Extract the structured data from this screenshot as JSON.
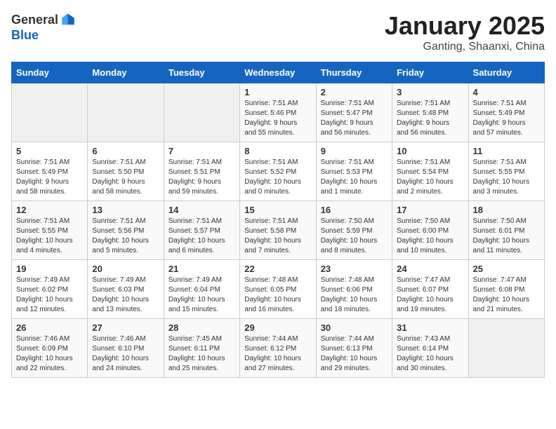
{
  "header": {
    "logo_general": "General",
    "logo_blue": "Blue",
    "title": "January 2025",
    "subtitle": "Ganting, Shaanxi, China"
  },
  "days_of_week": [
    "Sunday",
    "Monday",
    "Tuesday",
    "Wednesday",
    "Thursday",
    "Friday",
    "Saturday"
  ],
  "weeks": [
    [
      {
        "day": "",
        "info": ""
      },
      {
        "day": "",
        "info": ""
      },
      {
        "day": "",
        "info": ""
      },
      {
        "day": "1",
        "info": "Sunrise: 7:51 AM\nSunset: 5:46 PM\nDaylight: 9 hours\nand 55 minutes."
      },
      {
        "day": "2",
        "info": "Sunrise: 7:51 AM\nSunset: 5:47 PM\nDaylight: 9 hours\nand 56 minutes."
      },
      {
        "day": "3",
        "info": "Sunrise: 7:51 AM\nSunset: 5:48 PM\nDaylight: 9 hours\nand 56 minutes."
      },
      {
        "day": "4",
        "info": "Sunrise: 7:51 AM\nSunset: 5:49 PM\nDaylight: 9 hours\nand 57 minutes."
      }
    ],
    [
      {
        "day": "5",
        "info": "Sunrise: 7:51 AM\nSunset: 5:49 PM\nDaylight: 9 hours\nand 58 minutes."
      },
      {
        "day": "6",
        "info": "Sunrise: 7:51 AM\nSunset: 5:50 PM\nDaylight: 9 hours\nand 58 minutes."
      },
      {
        "day": "7",
        "info": "Sunrise: 7:51 AM\nSunset: 5:51 PM\nDaylight: 9 hours\nand 59 minutes."
      },
      {
        "day": "8",
        "info": "Sunrise: 7:51 AM\nSunset: 5:52 PM\nDaylight: 10 hours\nand 0 minutes."
      },
      {
        "day": "9",
        "info": "Sunrise: 7:51 AM\nSunset: 5:53 PM\nDaylight: 10 hours\nand 1 minute."
      },
      {
        "day": "10",
        "info": "Sunrise: 7:51 AM\nSunset: 5:54 PM\nDaylight: 10 hours\nand 2 minutes."
      },
      {
        "day": "11",
        "info": "Sunrise: 7:51 AM\nSunset: 5:55 PM\nDaylight: 10 hours\nand 3 minutes."
      }
    ],
    [
      {
        "day": "12",
        "info": "Sunrise: 7:51 AM\nSunset: 5:55 PM\nDaylight: 10 hours\nand 4 minutes."
      },
      {
        "day": "13",
        "info": "Sunrise: 7:51 AM\nSunset: 5:56 PM\nDaylight: 10 hours\nand 5 minutes."
      },
      {
        "day": "14",
        "info": "Sunrise: 7:51 AM\nSunset: 5:57 PM\nDaylight: 10 hours\nand 6 minutes."
      },
      {
        "day": "15",
        "info": "Sunrise: 7:51 AM\nSunset: 5:58 PM\nDaylight: 10 hours\nand 7 minutes."
      },
      {
        "day": "16",
        "info": "Sunrise: 7:50 AM\nSunset: 5:59 PM\nDaylight: 10 hours\nand 8 minutes."
      },
      {
        "day": "17",
        "info": "Sunrise: 7:50 AM\nSunset: 6:00 PM\nDaylight: 10 hours\nand 10 minutes."
      },
      {
        "day": "18",
        "info": "Sunrise: 7:50 AM\nSunset: 6:01 PM\nDaylight: 10 hours\nand 11 minutes."
      }
    ],
    [
      {
        "day": "19",
        "info": "Sunrise: 7:49 AM\nSunset: 6:02 PM\nDaylight: 10 hours\nand 12 minutes."
      },
      {
        "day": "20",
        "info": "Sunrise: 7:49 AM\nSunset: 6:03 PM\nDaylight: 10 hours\nand 13 minutes."
      },
      {
        "day": "21",
        "info": "Sunrise: 7:49 AM\nSunset: 6:04 PM\nDaylight: 10 hours\nand 15 minutes."
      },
      {
        "day": "22",
        "info": "Sunrise: 7:48 AM\nSunset: 6:05 PM\nDaylight: 10 hours\nand 16 minutes."
      },
      {
        "day": "23",
        "info": "Sunrise: 7:48 AM\nSunset: 6:06 PM\nDaylight: 10 hours\nand 18 minutes."
      },
      {
        "day": "24",
        "info": "Sunrise: 7:47 AM\nSunset: 6:07 PM\nDaylight: 10 hours\nand 19 minutes."
      },
      {
        "day": "25",
        "info": "Sunrise: 7:47 AM\nSunset: 6:08 PM\nDaylight: 10 hours\nand 21 minutes."
      }
    ],
    [
      {
        "day": "26",
        "info": "Sunrise: 7:46 AM\nSunset: 6:09 PM\nDaylight: 10 hours\nand 22 minutes."
      },
      {
        "day": "27",
        "info": "Sunrise: 7:46 AM\nSunset: 6:10 PM\nDaylight: 10 hours\nand 24 minutes."
      },
      {
        "day": "28",
        "info": "Sunrise: 7:45 AM\nSunset: 6:11 PM\nDaylight: 10 hours\nand 25 minutes."
      },
      {
        "day": "29",
        "info": "Sunrise: 7:44 AM\nSunset: 6:12 PM\nDaylight: 10 hours\nand 27 minutes."
      },
      {
        "day": "30",
        "info": "Sunrise: 7:44 AM\nSunset: 6:13 PM\nDaylight: 10 hours\nand 29 minutes."
      },
      {
        "day": "31",
        "info": "Sunrise: 7:43 AM\nSunset: 6:14 PM\nDaylight: 10 hours\nand 30 minutes."
      },
      {
        "day": "",
        "info": ""
      }
    ]
  ]
}
